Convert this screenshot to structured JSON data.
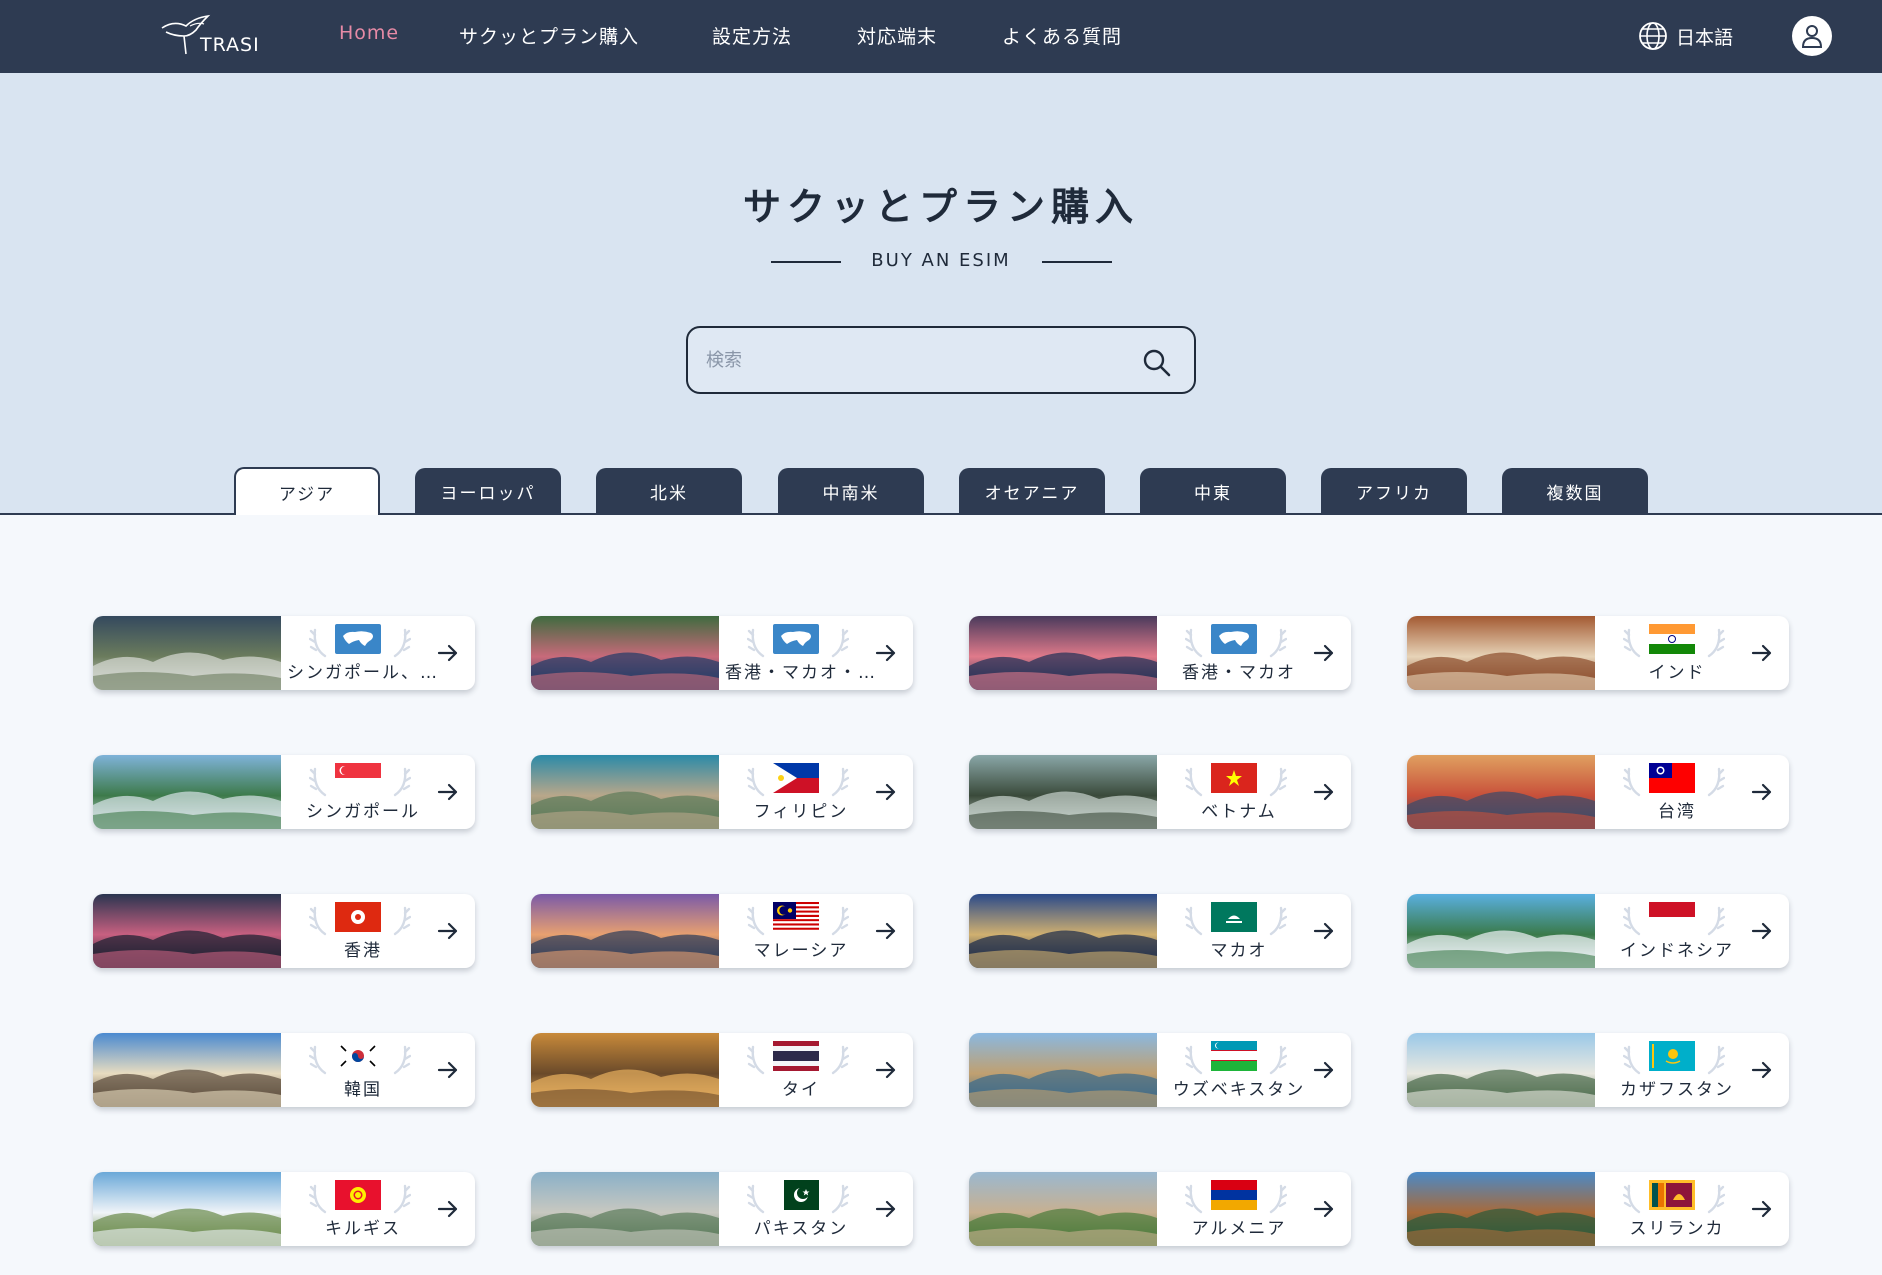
{
  "nav": {
    "logo_text": "TRASI",
    "items": [
      "Home",
      "サクッとプラン購入",
      "設定方法",
      "対応端末",
      "よくある質問"
    ],
    "language": "日本語"
  },
  "hero": {
    "title": "サクッとプラン購入",
    "subtitle": "BUY AN ESIM",
    "search_placeholder": "検索"
  },
  "tabs": [
    "アジア",
    "ヨーロッパ",
    "北米",
    "中南米",
    "オセアニア",
    "中東",
    "アフリカ",
    "複数国"
  ],
  "active_tab": 0,
  "colors": {
    "navy": "#2e3b52",
    "accent": "#e68aa6",
    "hero_bg": "#d9e4f1"
  },
  "cards": [
    {
      "name": "シンガポール、マ...",
      "flag": "asia-map"
    },
    {
      "name": "香港・マカオ・中国",
      "flag": "asia-map"
    },
    {
      "name": "香港・マカオ",
      "flag": "asia-map"
    },
    {
      "name": "インド",
      "flag": "india"
    },
    {
      "name": "シンガポール",
      "flag": "singapore"
    },
    {
      "name": "フィリピン",
      "flag": "philippines"
    },
    {
      "name": "ベトナム",
      "flag": "vietnam"
    },
    {
      "name": "台湾",
      "flag": "taiwan"
    },
    {
      "name": "香港",
      "flag": "hongkong"
    },
    {
      "name": "マレーシア",
      "flag": "malaysia"
    },
    {
      "name": "マカオ",
      "flag": "macau"
    },
    {
      "name": "インドネシア",
      "flag": "indonesia"
    },
    {
      "name": "韓国",
      "flag": "korea"
    },
    {
      "name": "タイ",
      "flag": "thailand"
    },
    {
      "name": "ウズベキスタン",
      "flag": "uzbekistan"
    },
    {
      "name": "カザフスタン",
      "flag": "kazakhstan"
    },
    {
      "name": "キルギス",
      "flag": "kyrgyzstan"
    },
    {
      "name": "パキスタン",
      "flag": "pakistan"
    },
    {
      "name": "アルメニア",
      "flag": "armenia"
    },
    {
      "name": "スリランカ",
      "flag": "srilanka"
    }
  ]
}
